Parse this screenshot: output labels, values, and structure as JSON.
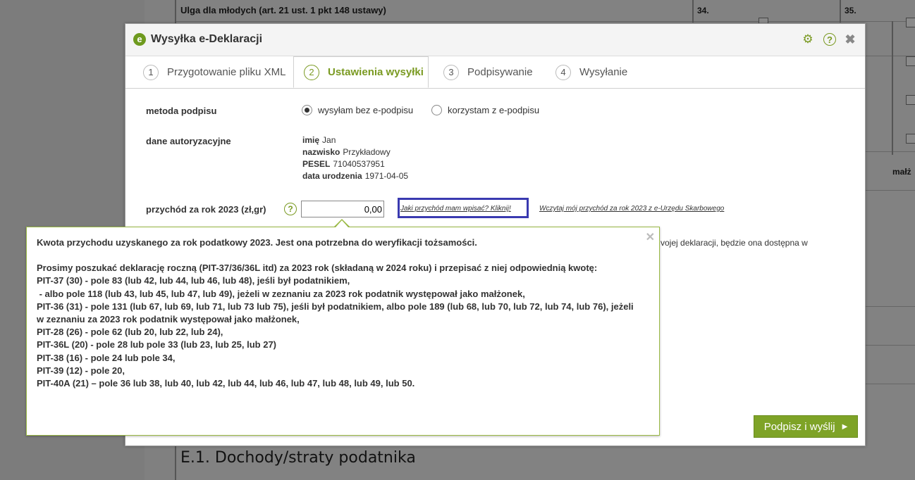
{
  "background": {
    "row_title": "Ulga dla młodych (art. 21 ust. 1 pkt 148 ustawy)",
    "cell_34": "34.",
    "cell_35": "35.",
    "col_label": "małż",
    "section_title": "E.1. Dochody/straty podatnika"
  },
  "dialog": {
    "title": "Wysyłka e-Deklaracji",
    "tabs": [
      {
        "num": "1",
        "label": "Przygotowanie pliku XML"
      },
      {
        "num": "2",
        "label": "Ustawienia wysyłki"
      },
      {
        "num": "3",
        "label": "Podpisywanie"
      },
      {
        "num": "4",
        "label": "Wysyłanie"
      }
    ],
    "signing_method_label": "metoda podpisu",
    "radio_no_signature": "wysyłam bez e-podpisu",
    "radio_with_signature": "korzystam z e-podpisu",
    "auth_label": "dane autoryzacyjne",
    "auth": {
      "name_key": "imię",
      "name_val": "Jan",
      "surname_key": "nazwisko",
      "surname_val": "Przykładowy",
      "pesel_key": "PESEL",
      "pesel_val": "71040537951",
      "dob_key": "data urodzenia",
      "dob_val": "1971-04-05"
    },
    "income_label": "przychód za rok 2023 (zł,gr)",
    "income_value": "0,00",
    "link_which_income": "Jaki przychód mam wpisać? Kliknij!",
    "link_load_income": "Wczytaj mój przychód za rok 2023 z e-Urzędu Skarbowego",
    "partial_text": "vojej deklaracji, będzie ona dostępna w",
    "submit_label": "Podpisz i wyślij"
  },
  "tooltip": {
    "line1": "Kwota przychodu uzyskanego za rok podatkowy 2023. Jest ona potrzebna do weryfikacji tożsamości.",
    "line2": "Prosimy poszukać deklarację roczną (PIT-37/36/36L itd) za 2023 rok (składaną w 2024 roku) i przepisać z niej odpowiednią kwotę:",
    "line3": "PIT-37 (30) - pole 83 (lub 42, lub 44, lub 46, lub 48), jeśli był podatnikiem,",
    "line4": " - albo pole 118 (lub 43, lub 45, lub 47, lub 49), jeżeli w zeznaniu za 2023 rok podatnik występował jako małżonek,",
    "line5": "PIT-36 (31) - pole 131 (lub 67, lub 69, lub 71, lub 73 lub 75), jeśli był podatnikiem, albo pole 189 (lub 68, lub 70, lub 72, lub 74, lub 76), jeżeli w zeznaniu za 2023 rok podatnik występował jako małżonek,",
    "line6": "PIT-28 (26) - pole 62 (lub 20, lub 22, lub 24),",
    "line7": "PIT-36L (20) - pole 28 lub pole 33 (lub 23, lub 25, lub 27)",
    "line8": "PIT-38 (16) - pole 24 lub pole 34,",
    "line9": "PIT-39 (12) - pole 20,",
    "line10": "PIT-40A (21) – pole 36 lub 38, lub 40, lub 42, lub 44, lub 46, lub 47, lub 48, lub 49, lub 50."
  }
}
